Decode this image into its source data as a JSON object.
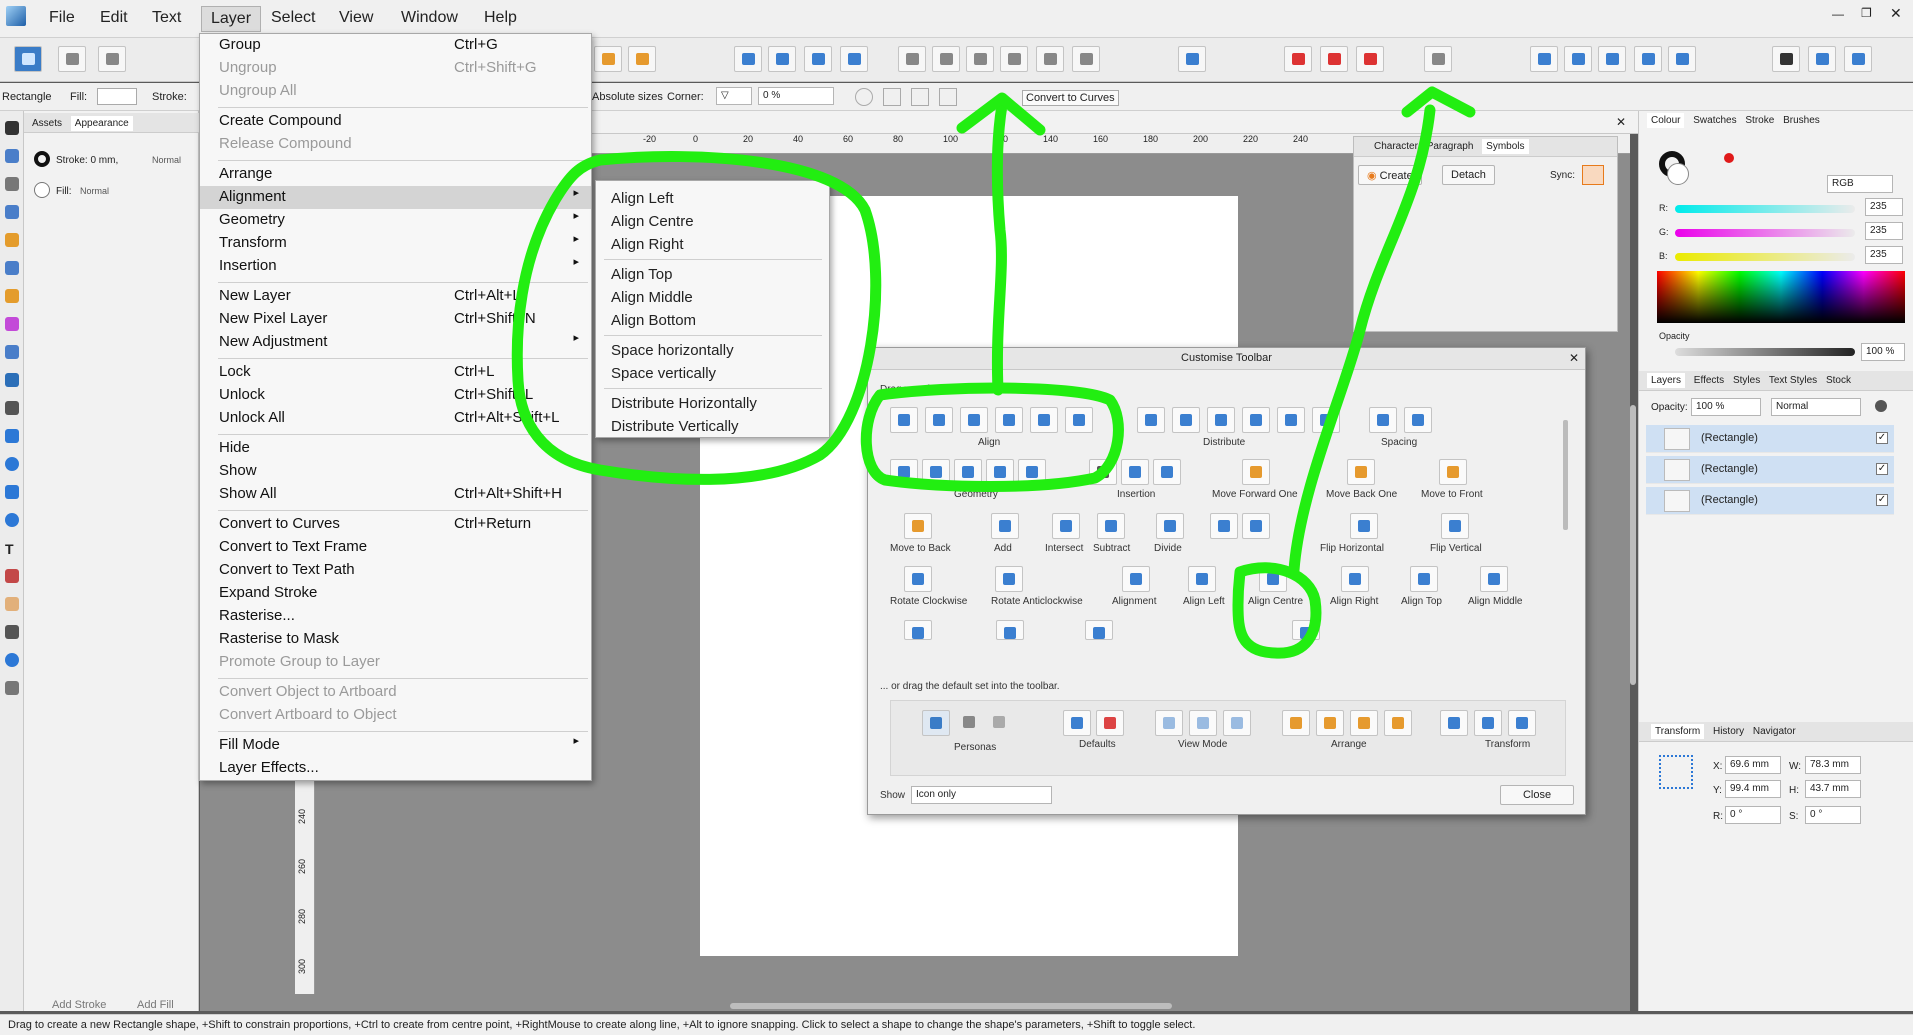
{
  "menubar": {
    "items": [
      "File",
      "Edit",
      "Text",
      "Layer",
      "Select",
      "View",
      "Window",
      "Help"
    ]
  },
  "context_bar": {
    "tool": "Rectangle",
    "fill_label": "Fill:",
    "stroke_label": "Stroke:",
    "absolute_sizes": "Absolute sizes",
    "corner_label": "Corner:",
    "corner_value": "0 %",
    "convert_button": "Convert to Curves"
  },
  "left_panel": {
    "tabs": [
      "Assets",
      "Appearance"
    ],
    "stroke": "Stroke: 0 mm,",
    "stroke_mode": "Normal",
    "fill": "Fill:",
    "fill_mode": "Normal",
    "add_stroke": "Add Stroke",
    "add_fill": "Add Fill"
  },
  "layer_menu": {
    "items": [
      {
        "label": "Group",
        "shortcut": "Ctrl+G",
        "disabled": false
      },
      {
        "label": "Ungroup",
        "shortcut": "Ctrl+Shift+G",
        "disabled": true
      },
      {
        "label": "Ungroup All",
        "shortcut": "",
        "disabled": true
      },
      {
        "label": "Create Compound",
        "shortcut": "",
        "disabled": false
      },
      {
        "label": "Release Compound",
        "shortcut": "",
        "disabled": true
      },
      {
        "label": "Arrange",
        "shortcut": "",
        "disabled": false,
        "submenu": true
      },
      {
        "label": "Alignment",
        "shortcut": "",
        "disabled": false,
        "submenu": true,
        "highlighted": true
      },
      {
        "label": "Geometry",
        "shortcut": "",
        "disabled": false,
        "submenu": true
      },
      {
        "label": "Transform",
        "shortcut": "",
        "disabled": false,
        "submenu": true
      },
      {
        "label": "Insertion",
        "shortcut": "",
        "disabled": false,
        "submenu": true
      },
      {
        "label": "New Layer",
        "shortcut": "Ctrl+Alt+L",
        "disabled": false
      },
      {
        "label": "New Pixel Layer",
        "shortcut": "Ctrl+Shift+N",
        "disabled": false
      },
      {
        "label": "New Adjustment",
        "shortcut": "",
        "disabled": false,
        "submenu": true
      },
      {
        "label": "Lock",
        "shortcut": "Ctrl+L",
        "disabled": false
      },
      {
        "label": "Unlock",
        "shortcut": "Ctrl+Shift+L",
        "disabled": false
      },
      {
        "label": "Unlock All",
        "shortcut": "Ctrl+Alt+Shift+L",
        "disabled": false
      },
      {
        "label": "Hide",
        "shortcut": "",
        "disabled": false
      },
      {
        "label": "Show",
        "shortcut": "",
        "disabled": false
      },
      {
        "label": "Show All",
        "shortcut": "Ctrl+Alt+Shift+H",
        "disabled": false
      },
      {
        "label": "Convert to Curves",
        "shortcut": "Ctrl+Return",
        "disabled": false
      },
      {
        "label": "Convert to Text Frame",
        "shortcut": "",
        "disabled": false
      },
      {
        "label": "Convert to Text Path",
        "shortcut": "",
        "disabled": false
      },
      {
        "label": "Expand Stroke",
        "shortcut": "",
        "disabled": false
      },
      {
        "label": "Rasterise...",
        "shortcut": "",
        "disabled": false
      },
      {
        "label": "Rasterise to Mask",
        "shortcut": "",
        "disabled": false
      },
      {
        "label": "Promote Group to Layer",
        "shortcut": "",
        "disabled": true
      },
      {
        "label": "Convert Object to Artboard",
        "shortcut": "",
        "disabled": true
      },
      {
        "label": "Convert Artboard to Object",
        "shortcut": "",
        "disabled": true
      },
      {
        "label": "Fill Mode",
        "shortcut": "",
        "disabled": false,
        "submenu": true
      },
      {
        "label": "Layer Effects...",
        "shortcut": "",
        "disabled": false
      }
    ]
  },
  "alignment_submenu": {
    "items": [
      "Align Left",
      "Align Centre",
      "Align Right",
      "Align Top",
      "Align Middle",
      "Align Bottom",
      "Space horizontally",
      "Space vertically",
      "Distribute Horizontally",
      "Distribute Vertically"
    ]
  },
  "ruler": {
    "h_ticks": [
      "-20",
      "0",
      "20",
      "40",
      "60",
      "80",
      "100",
      "120",
      "140",
      "160",
      "180",
      "200",
      "220",
      "240"
    ],
    "v_ticks": [
      "240",
      "260",
      "280",
      "300"
    ]
  },
  "symbols_panel": {
    "tabs": [
      "Character",
      "Paragraph",
      "Symbols"
    ],
    "create": "Create",
    "detach": "Detach",
    "sync": "Sync:"
  },
  "customise_toolbar": {
    "title": "Customise Toolbar",
    "hint": "Drag your favourite items into the toolbar.",
    "group_labels": [
      "Align",
      "Distribute",
      "Spacing"
    ],
    "row2": [
      "Geometry",
      "Insertion",
      "Move Forward One",
      "Move Back One",
      "Move to Front"
    ],
    "row3": [
      "Move to Back",
      "Add",
      "Intersect",
      "Subtract",
      "Divide",
      "Flip Horizontal",
      "Flip Vertical"
    ],
    "row4": [
      "Rotate Clockwise",
      "Rotate Anticlockwise",
      "Alignment",
      "Align Left",
      "Align Centre",
      "Align Right",
      "Align Top",
      "Align Middle"
    ],
    "default_hint": "... or drag the default set into the toolbar.",
    "defaults": [
      "Personas",
      "Defaults",
      "View Mode",
      "Arrange",
      "Transform"
    ],
    "show_label": "Show",
    "show_value": "Icon only",
    "close": "Close"
  },
  "colour_panel": {
    "tabs": [
      "Colour",
      "Swatches",
      "Stroke",
      "Brushes"
    ],
    "model": "RGB",
    "r": "235",
    "g": "235",
    "b": "235",
    "opacity_label": "Opacity",
    "opacity": "100 %"
  },
  "layers_panel": {
    "tabs": [
      "Layers",
      "Effects",
      "Styles",
      "Text Styles",
      "Stock"
    ],
    "opacity_label": "Opacity:",
    "opacity": "100 %",
    "blend": "Normal",
    "rows": [
      "(Rectangle)",
      "(Rectangle)",
      "(Rectangle)"
    ]
  },
  "transform_panel": {
    "tabs": [
      "Transform",
      "History",
      "Navigator"
    ],
    "x_label": "X:",
    "x": "69.6 mm",
    "y_label": "Y:",
    "y": "99.4 mm",
    "w_label": "W:",
    "w": "78.3 mm",
    "h_label": "H:",
    "h": "43.7 mm",
    "r_label": "R:",
    "r": "0 °",
    "s_label": "S:",
    "s": "0 °"
  },
  "status": {
    "text": "Drag to create a new Rectangle shape, +Shift to constrain proportions, +Ctrl to create from centre point, +RightMouse to create along line, +Alt to ignore snapping. Click to select a shape to change the shape's parameters, +Shift to toggle select."
  },
  "annotation_color": "#22ee11"
}
